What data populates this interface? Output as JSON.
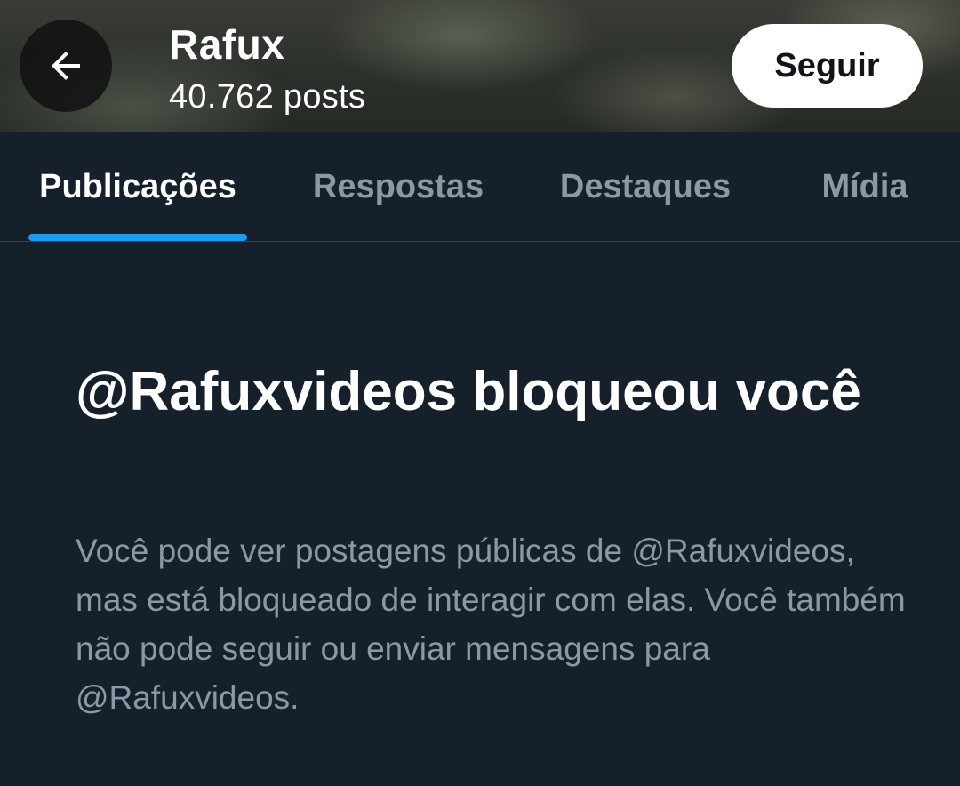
{
  "header": {
    "title": "Rafux",
    "posts_count": "40.762 posts",
    "follow_label": "Seguir",
    "back_icon": "arrow-left-icon"
  },
  "tabs": [
    {
      "label": "Publicações",
      "active": true
    },
    {
      "label": "Respostas",
      "active": false
    },
    {
      "label": "Destaques",
      "active": false
    },
    {
      "label": "Mídia",
      "active": false
    }
  ],
  "blocked": {
    "title": "@Rafuxvideos bloqueou você",
    "description": "Você pode ver postagens públicas de @Rafuxvideos, mas está bloqueado de interagir com elas. Você também não pode seguir ou enviar mensagens para @Rafuxvideos."
  },
  "colors": {
    "background": "#15202b",
    "accent": "#1d9bf0",
    "muted_text": "#8b98a5",
    "divider": "#38444d"
  }
}
